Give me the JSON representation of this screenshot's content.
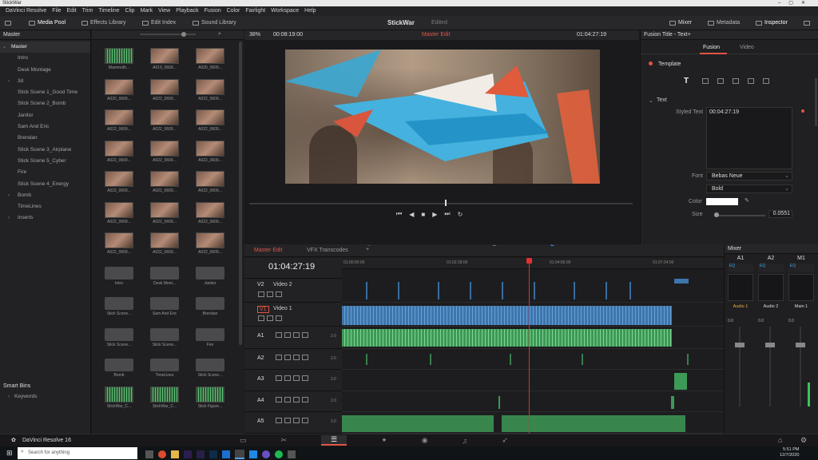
{
  "window": {
    "title": "StickWar"
  },
  "menu": [
    "DaVinci Resolve",
    "File",
    "Edit",
    "Trim",
    "Timeline",
    "Clip",
    "Mark",
    "View",
    "Playback",
    "Fusion",
    "Color",
    "Fairlight",
    "Workspace",
    "Help"
  ],
  "toolbar": {
    "media_pool": "Media Pool",
    "effects_library": "Effects Library",
    "edit_index": "Edit Index",
    "sound_library": "Sound Library",
    "project": "StickWar",
    "status": "Edited",
    "mixer": "Mixer",
    "metadata": "Metadata",
    "inspector": "Inspector"
  },
  "bins": {
    "header": "Master",
    "items": [
      "Master",
      "Intro",
      "Desk Montage",
      "3d",
      "Stick Scene 1_Good Time",
      "Stick Scene 2_Bomb",
      "Janitor",
      "Sam And Eric",
      "Brendan",
      "Stick Scene 3_Airplane",
      "Stick Scene 5_Cyber",
      "Fire",
      "Stick Scene 4_Energy",
      "Bomb",
      "TimeLines",
      "Inserts"
    ],
    "smart_bins": "Smart Bins",
    "keywords": "Keywords"
  },
  "clips": [
    {
      "label": "Mammoth...",
      "kind": "aud"
    },
    {
      "label": "A019_0609...",
      "kind": "vid"
    },
    {
      "label": "A020_0609...",
      "kind": "vid"
    },
    {
      "label": "A020_0609...",
      "kind": "vid"
    },
    {
      "label": "A022_0609...",
      "kind": "vid"
    },
    {
      "label": "A022_0609...",
      "kind": "vid"
    },
    {
      "label": "A022_0609...",
      "kind": "vid"
    },
    {
      "label": "A022_0609...",
      "kind": "vid"
    },
    {
      "label": "A022_0609...",
      "kind": "vid"
    },
    {
      "label": "A022_0609...",
      "kind": "vid"
    },
    {
      "label": "A022_0609...",
      "kind": "vid"
    },
    {
      "label": "A022_0609...",
      "kind": "vid"
    },
    {
      "label": "A022_0609...",
      "kind": "vid"
    },
    {
      "label": "A022_0609...",
      "kind": "vid"
    },
    {
      "label": "A022_0609...",
      "kind": "vid"
    },
    {
      "label": "A022_0609...",
      "kind": "vid"
    },
    {
      "label": "A022_0609...",
      "kind": "vid"
    },
    {
      "label": "A022_0609...",
      "kind": "vid"
    },
    {
      "label": "A022_0609...",
      "kind": "vid"
    },
    {
      "label": "A022_0609...",
      "kind": "vid"
    },
    {
      "label": "A022_0609...",
      "kind": "vid"
    },
    {
      "label": "Intro",
      "kind": "fold"
    },
    {
      "label": "Desk Mont...",
      "kind": "fold"
    },
    {
      "label": "Janitor",
      "kind": "fold"
    },
    {
      "label": "Stick Scene...",
      "kind": "fold"
    },
    {
      "label": "Sam And Eric",
      "kind": "fold"
    },
    {
      "label": "Brendan",
      "kind": "fold"
    },
    {
      "label": "Stick Scene...",
      "kind": "fold"
    },
    {
      "label": "Stick Scene...",
      "kind": "fold"
    },
    {
      "label": "Fire",
      "kind": "fold"
    },
    {
      "label": "Bomb",
      "kind": "fold"
    },
    {
      "label": "TimeLines",
      "kind": "fold"
    },
    {
      "label": "Stick Scene...",
      "kind": "fold"
    },
    {
      "label": "StickWar_C...",
      "kind": "aud"
    },
    {
      "label": "StickWar_C...",
      "kind": "aud"
    },
    {
      "label": "Stick Figure...",
      "kind": "aud"
    }
  ],
  "viewer": {
    "zoom": "38%",
    "source_tc": "00:08:19:00",
    "timeline_name": "Master Edit",
    "record_tc": "01:04:27:19",
    "playhead_fraction": 0.51
  },
  "inspector": {
    "title": "Fusion Title - Text+",
    "tabs": [
      "Fusion",
      "Video"
    ],
    "template": "Template",
    "section": "Text",
    "styled_label": "Styled Text",
    "styled_value": "00:04:27:19",
    "font_label": "Font",
    "font_value": "Bebas Neue",
    "weight_value": "Bold",
    "color_label": "Color",
    "size_label": "Size",
    "size_value": "0.0551"
  },
  "timeline": {
    "tabs": [
      "Master Edit",
      "VFX Transcodes"
    ],
    "timecode": "01:04:27:19",
    "ruler": [
      "01:00:00:00",
      "01:02:28:00",
      "01:04:56:00",
      "01:07:24:00"
    ],
    "playhead_fraction": 0.49,
    "tracks": [
      {
        "id": "V2",
        "name": "Video 2"
      },
      {
        "id": "V1",
        "name": "Video 1"
      },
      {
        "id": "A1",
        "level": "2.0"
      },
      {
        "id": "A2",
        "level": "2.0"
      },
      {
        "id": "A3",
        "level": "2.0"
      },
      {
        "id": "A4",
        "level": "2.0"
      },
      {
        "id": "A5",
        "level": "2.0"
      }
    ],
    "colors": {
      "video": "#3d75ad",
      "audio": "#3d9956",
      "playhead": "#e03030"
    }
  },
  "mixer": {
    "title": "Mixer",
    "channels": [
      "A1",
      "A2",
      "M1"
    ],
    "eq": "EQ",
    "buses": [
      "Audio 1",
      "Audio 2",
      "Main 1"
    ],
    "value": "0.0"
  },
  "pagebar": {
    "app": "DaVinci Resolve 16"
  },
  "taskbar": {
    "search": "Search for anything",
    "time": "5:51 PM",
    "date": "12/7/2020"
  }
}
